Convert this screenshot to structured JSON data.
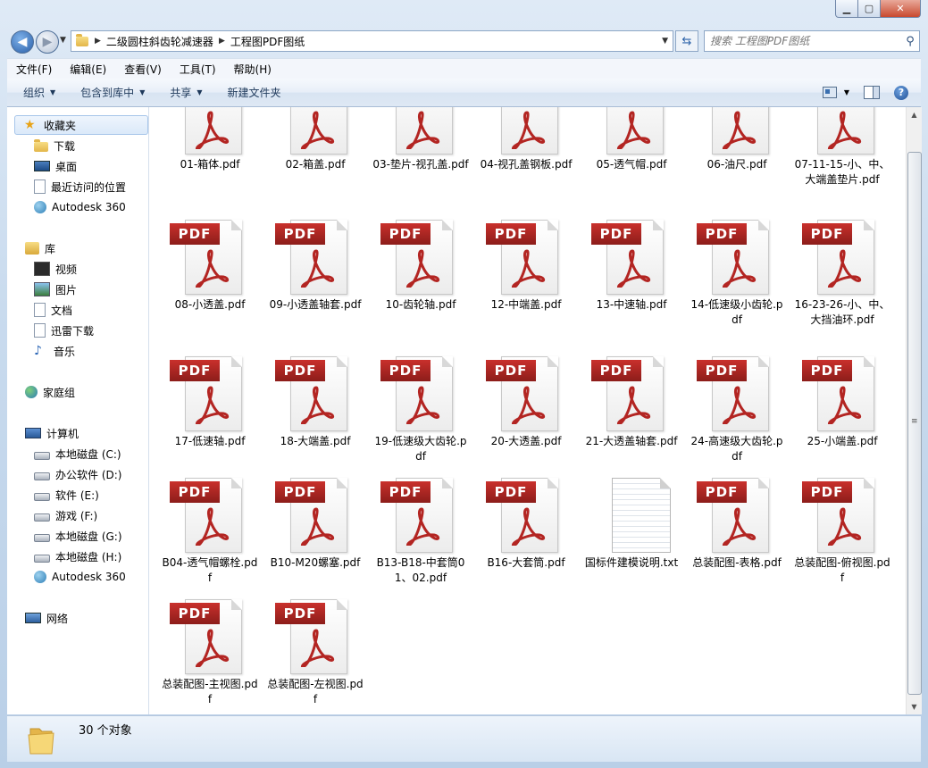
{
  "address": {
    "crumbs": [
      "二级圆柱斜齿轮减速器",
      "工程图PDF图纸"
    ]
  },
  "search": {
    "placeholder": "搜索 工程图PDF图纸"
  },
  "menu": [
    "文件(F)",
    "编辑(E)",
    "查看(V)",
    "工具(T)",
    "帮助(H)"
  ],
  "commands": [
    "组织",
    "包含到库中",
    "共享",
    "新建文件夹"
  ],
  "sidebar": {
    "favorites": {
      "label": "收藏夹",
      "items": [
        "下载",
        "桌面",
        "最近访问的位置",
        "Autodesk 360"
      ]
    },
    "libraries": {
      "label": "库",
      "items": [
        "视频",
        "图片",
        "文档",
        "迅雷下载",
        "音乐"
      ]
    },
    "homegroup": {
      "label": "家庭组"
    },
    "computer": {
      "label": "计算机",
      "items": [
        "本地磁盘 (C:)",
        "办公软件 (D:)",
        "软件 (E:)",
        "游戏 (F:)",
        "本地磁盘 (G:)",
        "本地磁盘 (H:)",
        "Autodesk 360"
      ]
    },
    "network": {
      "label": "网络"
    }
  },
  "files": [
    {
      "name": "01-箱体.pdf",
      "type": "pdf",
      "badge": false
    },
    {
      "name": "02-箱盖.pdf",
      "type": "pdf",
      "badge": false
    },
    {
      "name": "03-垫片-视孔盖.pdf",
      "type": "pdf",
      "badge": false
    },
    {
      "name": "04-视孔盖钢板.pdf",
      "type": "pdf",
      "badge": false
    },
    {
      "name": "05-透气帽.pdf",
      "type": "pdf",
      "badge": false
    },
    {
      "name": "06-油尺.pdf",
      "type": "pdf",
      "badge": false
    },
    {
      "name": "07-11-15-小、中、大端盖垫片.pdf",
      "type": "pdf",
      "badge": false
    },
    {
      "name": "08-小透盖.pdf",
      "type": "pdf",
      "badge": true
    },
    {
      "name": "09-小透盖轴套.pdf",
      "type": "pdf",
      "badge": true
    },
    {
      "name": "10-齿轮轴.pdf",
      "type": "pdf",
      "badge": true
    },
    {
      "name": "12-中端盖.pdf",
      "type": "pdf",
      "badge": true
    },
    {
      "name": "13-中速轴.pdf",
      "type": "pdf",
      "badge": true
    },
    {
      "name": "14-低速级小齿轮.pdf",
      "type": "pdf",
      "badge": true
    },
    {
      "name": "16-23-26-小、中、大挡油环.pdf",
      "type": "pdf",
      "badge": true
    },
    {
      "name": "17-低速轴.pdf",
      "type": "pdf",
      "badge": true
    },
    {
      "name": "18-大端盖.pdf",
      "type": "pdf",
      "badge": true
    },
    {
      "name": "19-低速级大齿轮.pdf",
      "type": "pdf",
      "badge": true
    },
    {
      "name": "20-大透盖.pdf",
      "type": "pdf",
      "badge": true
    },
    {
      "name": "21-大透盖轴套.pdf",
      "type": "pdf",
      "badge": true
    },
    {
      "name": "24-高速级大齿轮.pdf",
      "type": "pdf",
      "badge": true
    },
    {
      "name": "25-小端盖.pdf",
      "type": "pdf",
      "badge": true
    },
    {
      "name": "B04-透气帽螺栓.pdf",
      "type": "pdf",
      "badge": true
    },
    {
      "name": "B10-M20螺塞.pdf",
      "type": "pdf",
      "badge": true
    },
    {
      "name": "B13-B18-中套筒01、02.pdf",
      "type": "pdf",
      "badge": true
    },
    {
      "name": "B16-大套筒.pdf",
      "type": "pdf",
      "badge": true
    },
    {
      "name": "国标件建模说明.txt",
      "type": "txt",
      "badge": false
    },
    {
      "name": "总装配图-表格.pdf",
      "type": "pdf",
      "badge": true
    },
    {
      "name": "总装配图-俯视图.pdf",
      "type": "pdf",
      "badge": true
    },
    {
      "name": "总装配图-主视图.pdf",
      "type": "pdf",
      "badge": true
    },
    {
      "name": "总装配图-左视图.pdf",
      "type": "pdf",
      "badge": true
    }
  ],
  "pdf_badge_label": "PDF",
  "status": {
    "count_text": "30 个对象"
  },
  "colors": {
    "pdf_red": "#b32522",
    "accent": "#2a5fa8"
  }
}
